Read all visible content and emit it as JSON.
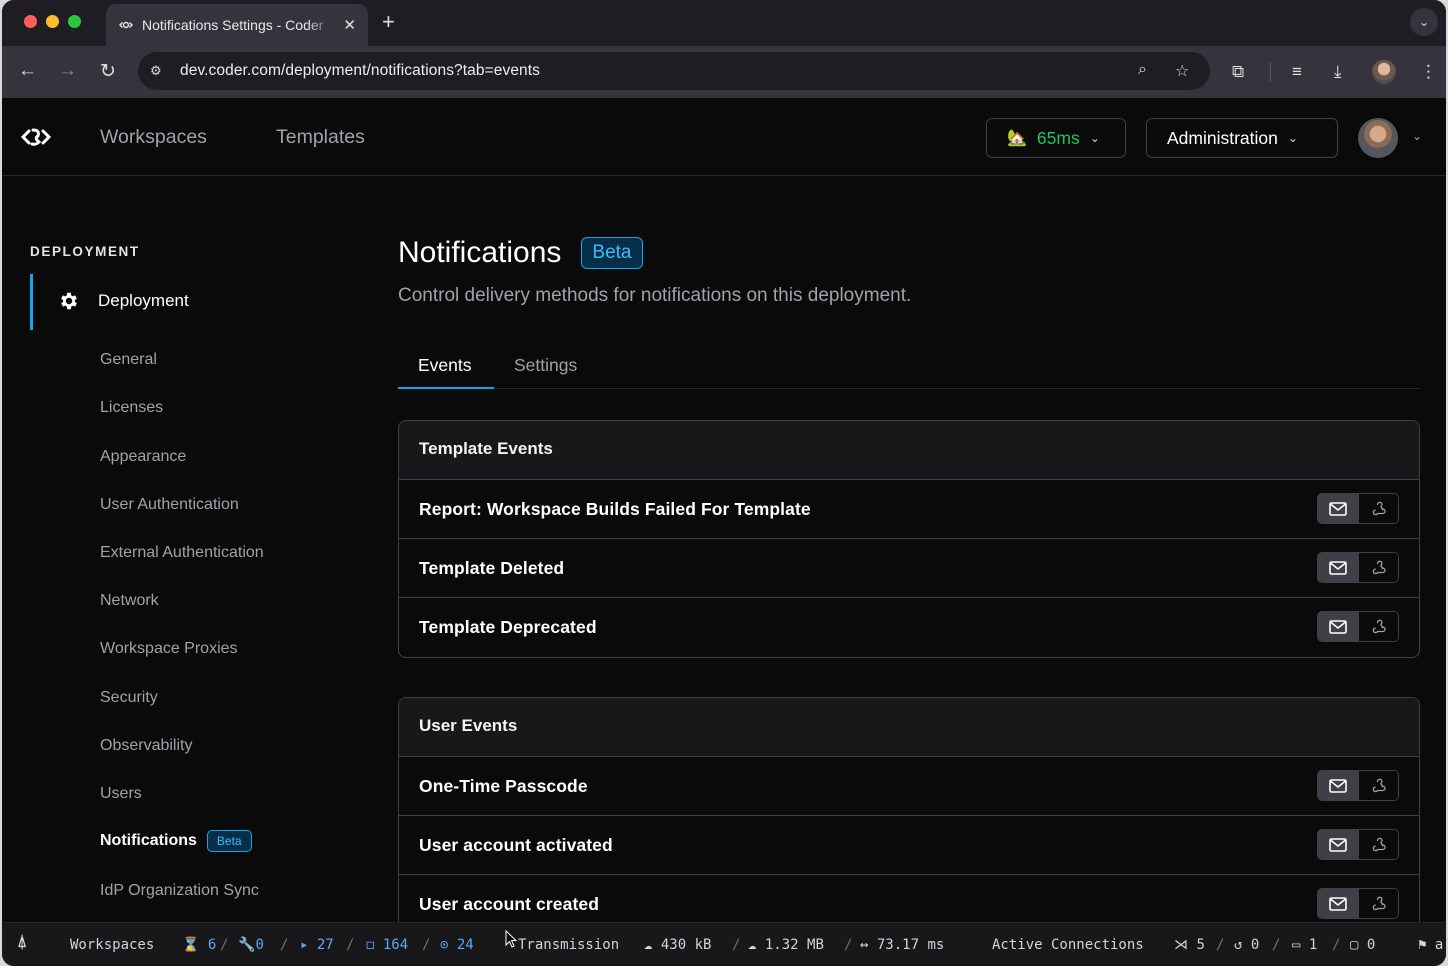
{
  "browser": {
    "tab_title": "Notifications Settings - Coder",
    "url": "dev.coder.com/deployment/notifications?tab=events"
  },
  "header": {
    "nav": [
      "Workspaces",
      "Templates"
    ],
    "latency": "65ms",
    "admin_label": "Administration"
  },
  "sidebar": {
    "section": "DEPLOYMENT",
    "parent": "Deployment",
    "items": [
      "General",
      "Licenses",
      "Appearance",
      "User Authentication",
      "External Authentication",
      "Network",
      "Workspace Proxies",
      "Security",
      "Observability",
      "Users",
      "Notifications",
      "IdP Organization Sync"
    ],
    "active_badge": "Beta"
  },
  "page": {
    "title": "Notifications",
    "badge": "Beta",
    "subtitle": "Control delivery methods for notifications on this deployment.",
    "tabs": [
      "Events",
      "Settings"
    ]
  },
  "groups": [
    {
      "title": "Template Events",
      "events": [
        "Report: Workspace Builds Failed For Template",
        "Template Deleted",
        "Template Deprecated"
      ]
    },
    {
      "title": "User Events",
      "events": [
        "One-Time Passcode",
        "User account activated",
        "User account created"
      ]
    }
  ],
  "statusbar": {
    "workspaces": "Workspaces",
    "c1": "6",
    "c2": "0",
    "c3": "27",
    "c4": "164",
    "c5": "24",
    "transmission": "Transmission",
    "up": "430 kB",
    "down": "1.32 MB",
    "ping": "73.17 ms",
    "active": "Active Connections",
    "a1": "5",
    "a2": "0",
    "a3": "1",
    "a4": "0",
    "tail": "a"
  },
  "icons": {
    "email": "mail-icon",
    "webhook": "webhook-icon",
    "settings": "gear-icon"
  },
  "colors": {
    "accent": "#0ea5e9",
    "latency": "#22c55e",
    "background": "#0a0a0b"
  }
}
